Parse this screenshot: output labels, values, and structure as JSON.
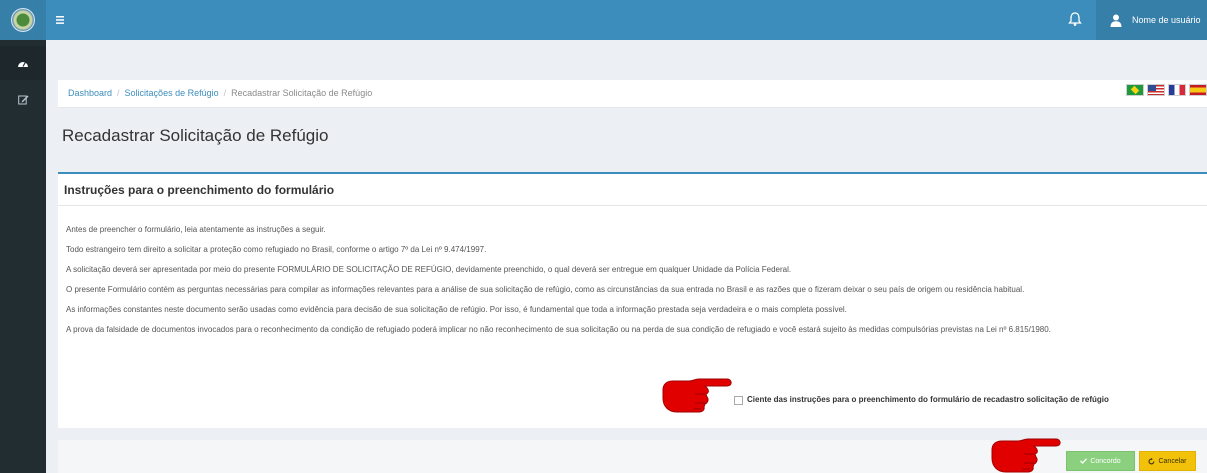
{
  "navbar": {
    "menu_icon": "bars-icon",
    "notifications_icon": "bell-icon",
    "user_icon": "user-icon",
    "user_name": "Nome de usuário"
  },
  "sidebar": {
    "items": [
      {
        "icon": "dashboard-icon"
      },
      {
        "icon": "edit-icon"
      }
    ]
  },
  "breadcrumb": {
    "items": [
      "Dashboard",
      "Solicitações de Refúgio",
      "Recadastrar Solicitação de Refúgio"
    ]
  },
  "languages": [
    "Português",
    "English",
    "Français",
    "Español"
  ],
  "page": {
    "title": "Recadastrar Solicitação de Refúgio"
  },
  "instructions": {
    "title": "Instruções para o preenchimento do formulário",
    "paragraphs": [
      "Antes de preencher o formulário, leia atentamente as instruções a seguir.",
      "Todo estrangeiro tem direito a solicitar a proteção como refugiado no Brasil, conforme o artigo 7º da Lei nº 9.474/1997.",
      "A solicitação deverá ser apresentada por meio do presente FORMULÁRIO DE SOLICITAÇÃO DE REFÚGIO, devidamente preenchido, o qual deverá ser entregue em qualquer Unidade da Polícia Federal.",
      "O presente Formulário contém as perguntas necessárias para compilar as informações relevantes para a análise de sua solicitação de refúgio, como as circunstâncias da sua entrada no Brasil e as razões que o fizeram deixar o seu país de origem ou residência habitual.",
      "As informações constantes neste documento serão usadas como evidência para decisão de sua solicitação de refúgio. Por isso, é fundamental que toda a informação prestada seja verdadeira e o mais completa possível.",
      "A prova da falsidade de documentos invocados para o reconhecimento da condição de refugiado poderá implicar no não reconhecimento de sua solicitação ou na perda de sua condição de refugiado e você estará sujeito às medidas compulsórias previstas na Lei nº 6.815/1980."
    ],
    "acknowledge_label": "Ciente das instruções para o preenchimento do formulário de recadastro solicitação de refúgio",
    "acknowledge_checked": false
  },
  "actions": {
    "agree_label": "Concordo",
    "agree_icon": "check-icon",
    "cancel_label": "Cancelar",
    "cancel_icon": "undo-icon"
  },
  "colors": {
    "navbar": "#3c8dbc",
    "sidebar": "#222d32",
    "agree": "#8bd07f",
    "cancel": "#f2c20a",
    "pointer": "#e00000"
  }
}
